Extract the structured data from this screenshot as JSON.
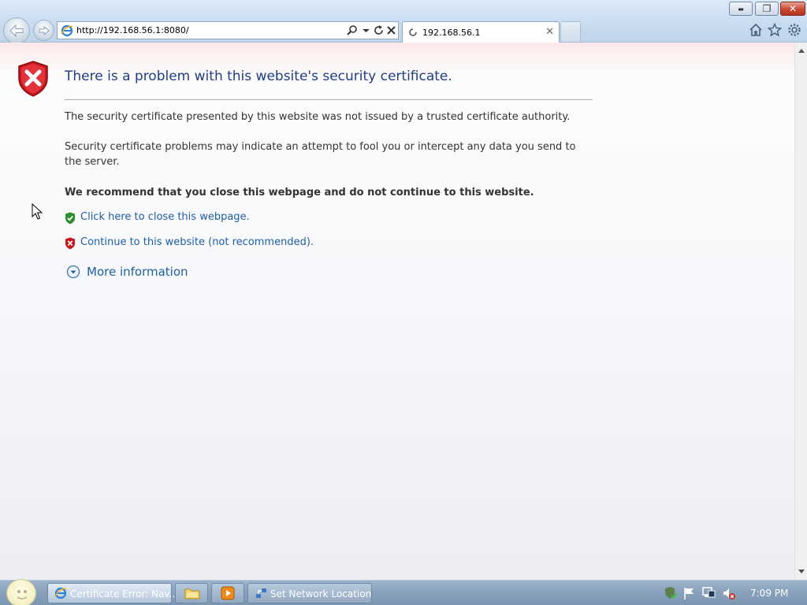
{
  "browser": {
    "address": {
      "url": "http://192.168.56.1:8080/"
    },
    "tab": {
      "title": "192.168.56.1",
      "close_glyph": "✕"
    },
    "window_controls": {
      "minimize": "▬",
      "maximize": "❐",
      "close": "✕"
    },
    "icons": [
      "back-arrow-icon",
      "forward-arrow-icon",
      "ie-page-icon",
      "search-icon",
      "dropdown-icon",
      "refresh-icon",
      "stop-icon",
      "loading-spinner-icon",
      "home-icon",
      "favorites-star-icon",
      "tools-gear-icon"
    ]
  },
  "page": {
    "heading": "There is a problem with this website's security certificate.",
    "para1": "The security certificate presented by this website was not issued by a trusted certificate authority.",
    "para2": "Security certificate problems may indicate an attempt to fool you or intercept any data you send to the server.",
    "recommend": "We recommend that you close this webpage and do not continue to this website.",
    "close_link": "Click here to close this webpage.",
    "continue_link": "Continue to this website (not recommended).",
    "more_info": "More information",
    "colors": {
      "heading": "#1f3c86",
      "link": "#1e5fa7",
      "danger": "#c8161d",
      "safe": "#2f8f2f"
    }
  },
  "taskbar": {
    "items": [
      {
        "label": "Certificate Error: Nav...",
        "icon": "ie-icon",
        "active": true
      },
      {
        "label": "",
        "icon": "folder-icon",
        "active": false
      },
      {
        "label": "",
        "icon": "media-player-icon",
        "active": false
      },
      {
        "label": "Set Network Location",
        "icon": "network-icon",
        "active": false
      }
    ],
    "tray_icons": [
      "security-shield-icon",
      "action-center-flag-icon",
      "network-status-icon",
      "volume-muted-icon"
    ],
    "clock": "7:09 PM"
  }
}
